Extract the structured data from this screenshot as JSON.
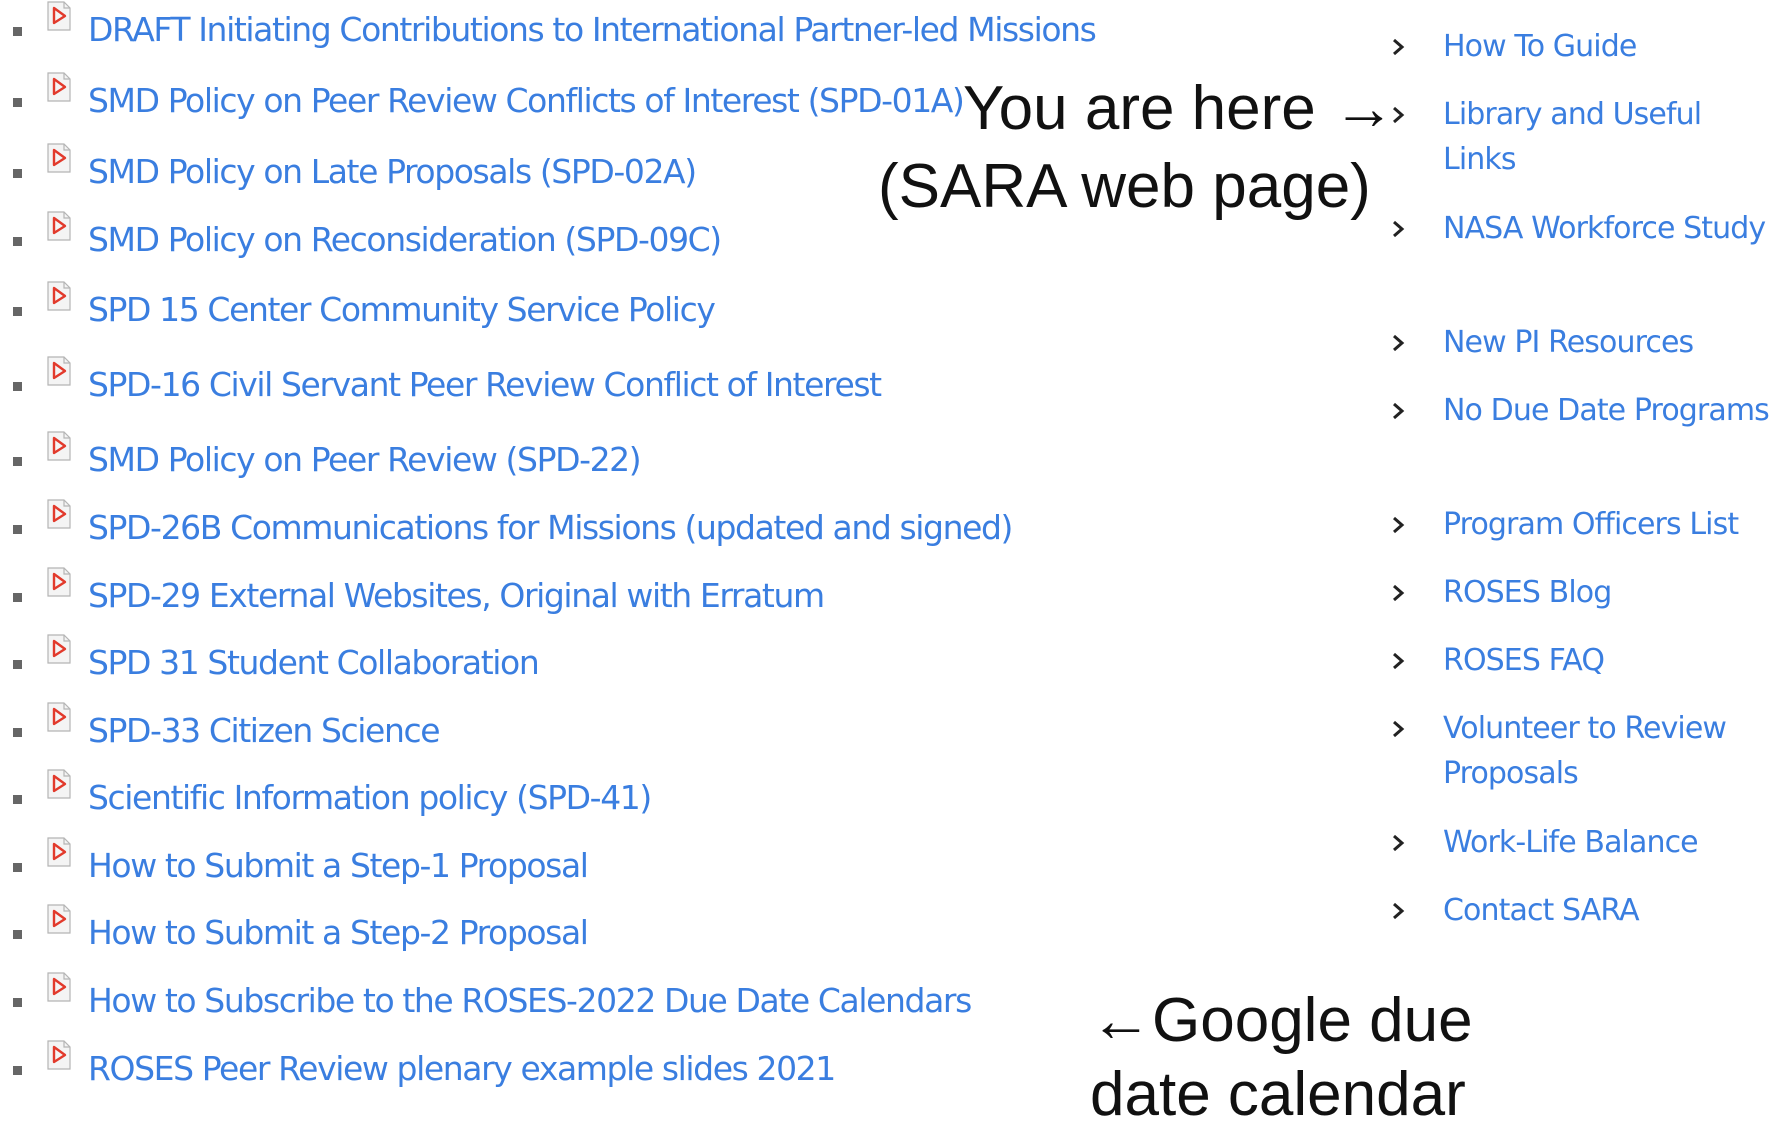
{
  "documents": [
    "DRAFT Initiating Contributions to International Partner-led Missions",
    "SMD Policy on Peer Review Conflicts of Interest (SPD-01A)",
    "SMD Policy on Late Proposals (SPD-02A)",
    "SMD Policy on Reconsideration (SPD-09C)",
    "SPD 15 Center Community Service Policy",
    "SPD-16 Civil Servant Peer Review Conflict of Interest",
    "SMD Policy on Peer Review (SPD-22)",
    "SPD-26B Communications for Missions (updated and signed)",
    "SPD-29 External Websites, Original with Erratum",
    "SPD 31 Student Collaboration",
    "SPD-33 Citizen Science",
    "Scientific Information policy (SPD-41)",
    "How to Submit a Step-1 Proposal",
    "How to Submit a Step-2 Proposal",
    "How to Subscribe to the ROSES-2022 Due Date Calendars",
    "ROSES Peer Review plenary example slides 2021"
  ],
  "sidebar": [
    "How To Guide",
    "Library and Useful Links",
    "NASA Workforce Study",
    "New PI Resources",
    "No Due Date Programs",
    "Program Officers List",
    "ROSES Blog",
    "ROSES FAQ",
    "Volunteer to Review Proposals",
    "Work-Life Balance",
    "Contact SARA"
  ],
  "annotations": {
    "you_are_here_line1": "You are here →",
    "you_are_here_line2": "(SARA web page)",
    "google_line1": "←Google due",
    "google_line2": "date calendar"
  },
  "icons": {
    "document": "pdf-icon",
    "bullet": "square-bullet",
    "nav": "chevron-right-icon"
  },
  "colors": {
    "link": "#3a7ee0",
    "pdf_red": "#e23a2c",
    "bullet": "#666666",
    "annotation": "#111111"
  }
}
